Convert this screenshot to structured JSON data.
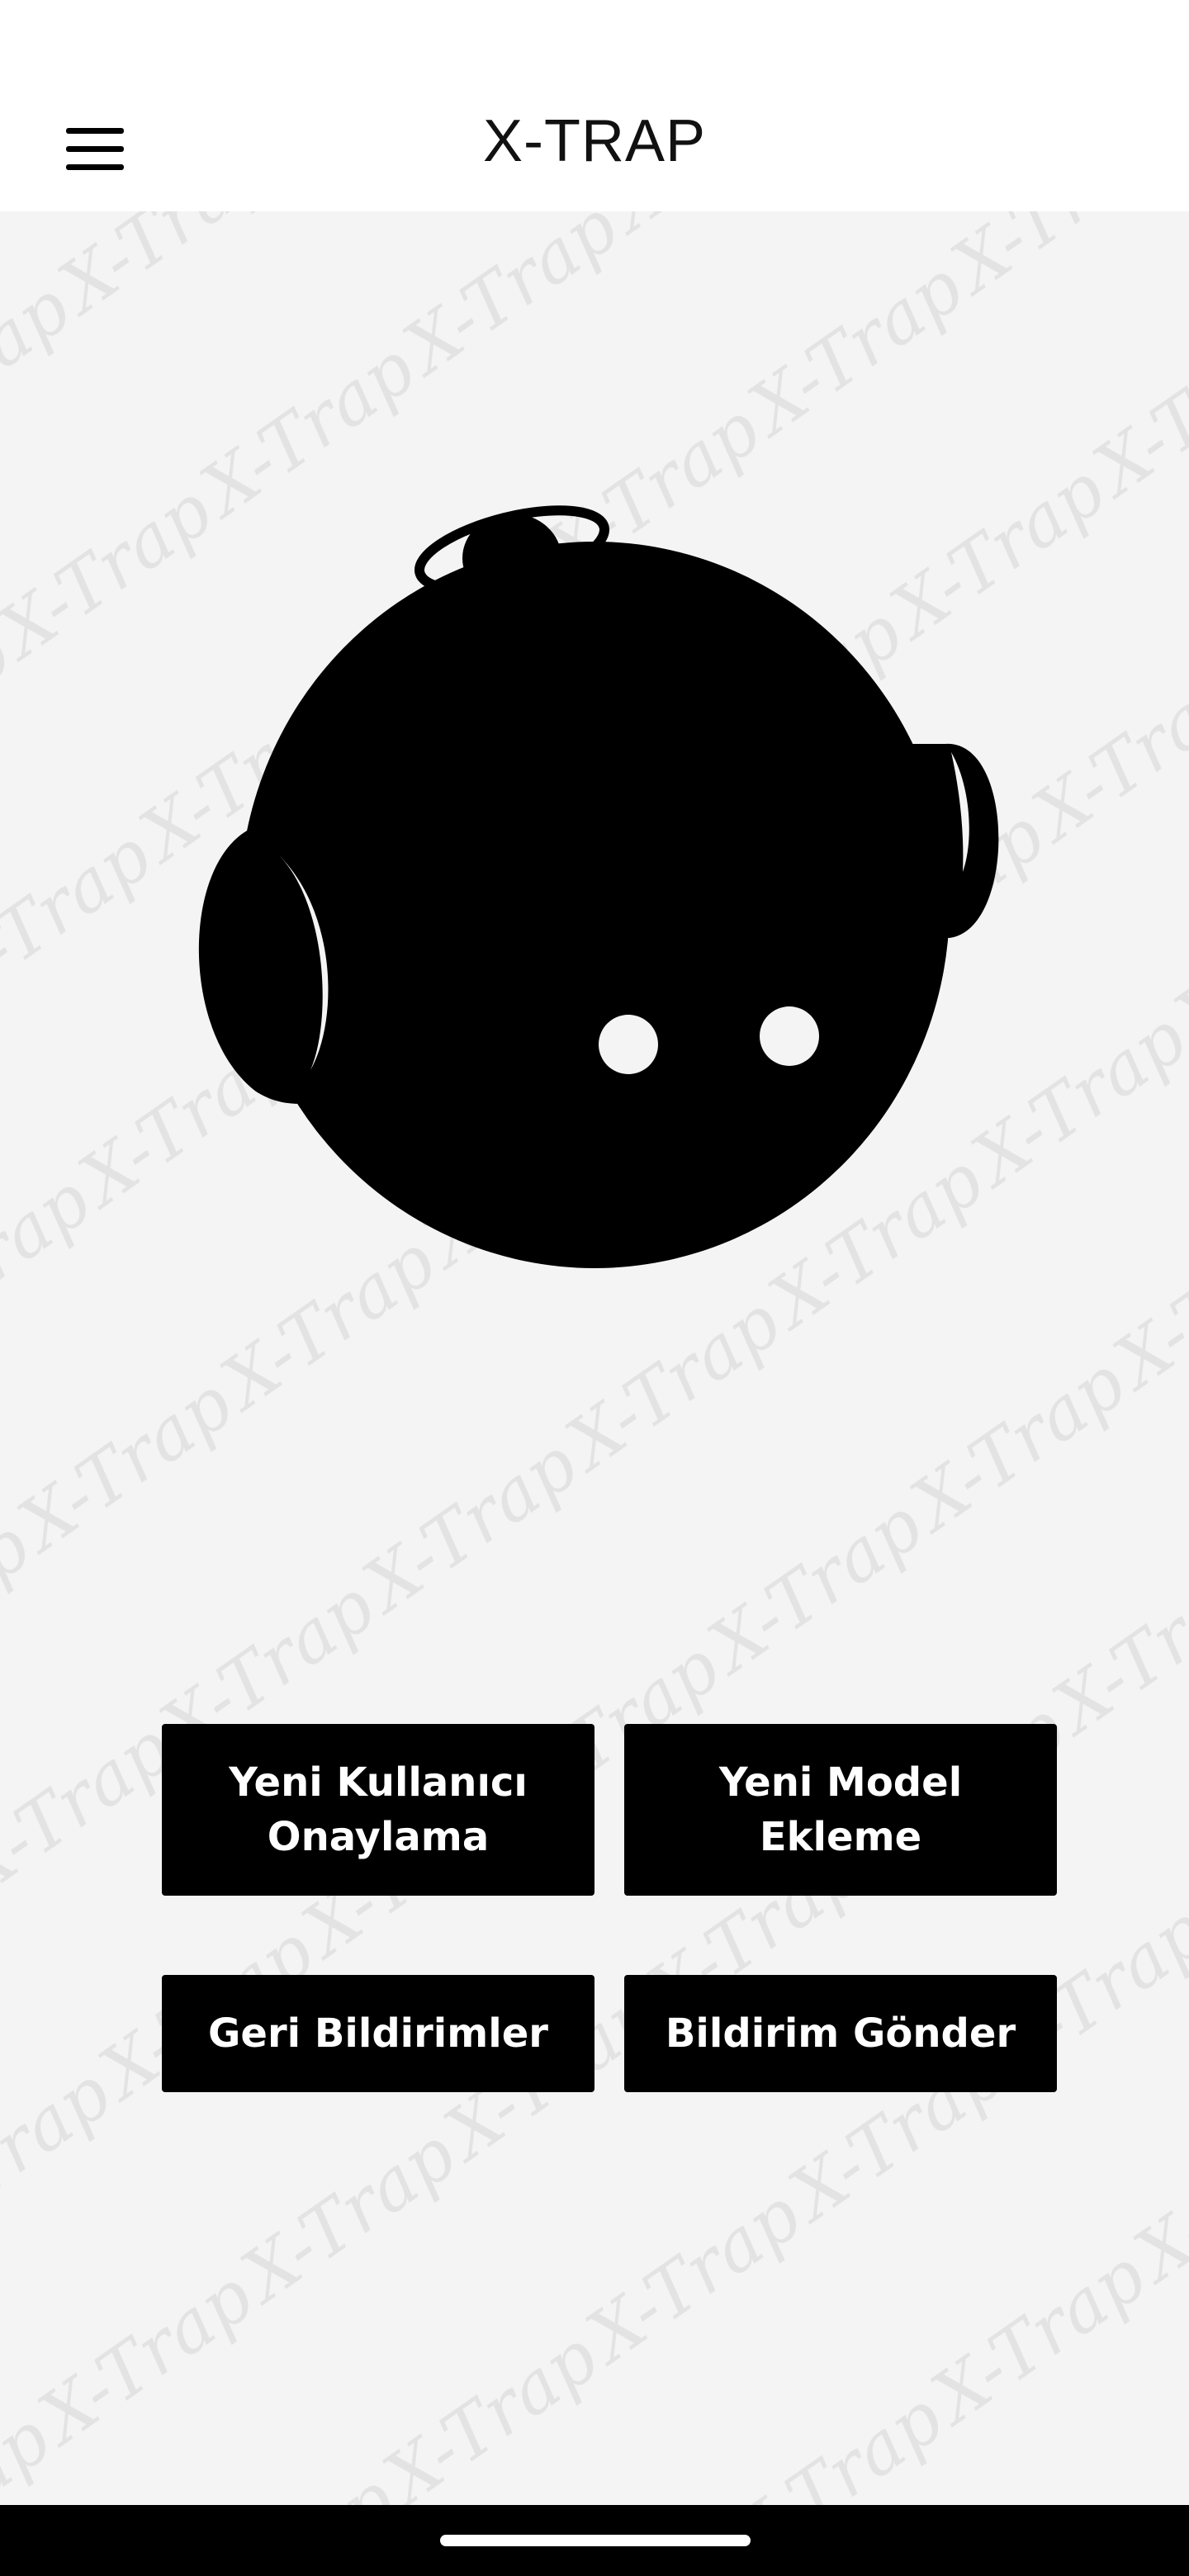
{
  "app_bar": {
    "title": "X-TRAP",
    "menu_icon": "hamburger-menu-icon"
  },
  "watermark": {
    "text": "X-Trap"
  },
  "mascot": {
    "icon": "robot-mascot-icon"
  },
  "buttons": {
    "approve_user": "Yeni Kullanıcı\nOnaylama",
    "add_model": "Yeni Model\nEkleme",
    "feedbacks": "Geri Bildirimler",
    "send_notification": "Bildirim Gönder"
  },
  "colors": {
    "background": "#f4f4f4",
    "bar": "#ffffff",
    "button": "#000000",
    "button_text": "#ffffff"
  }
}
